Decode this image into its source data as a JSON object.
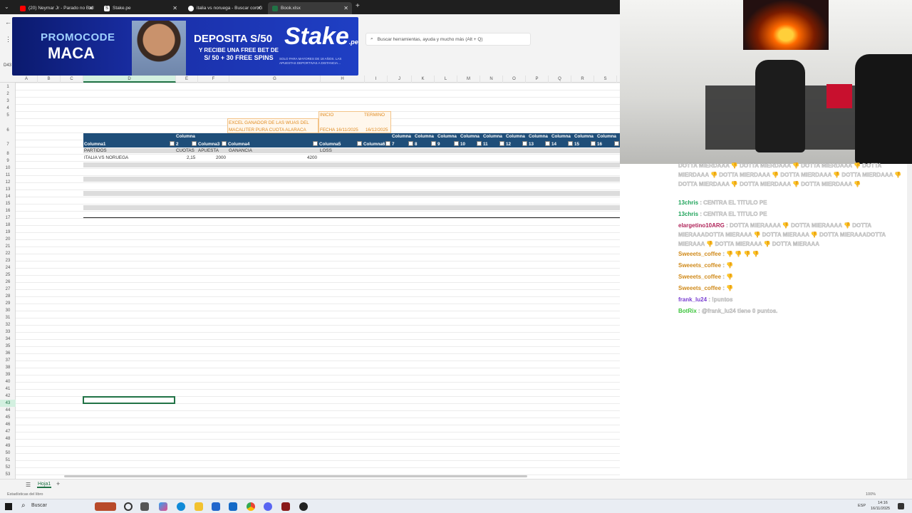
{
  "browser": {
    "tabs": [
      {
        "label": "(20) Neymar Jr - Parado no Bail",
        "icon": "youtube-icon",
        "color": "#ff0000"
      },
      {
        "label": "Stake.pe",
        "icon": "stake-icon",
        "color": "#ffffff"
      },
      {
        "label": "italia vs noruega - Buscar con G",
        "icon": "google-icon",
        "color": "#ffffff"
      },
      {
        "label": "Book.xlsx",
        "icon": "excel-icon",
        "color": "#217346"
      }
    ],
    "new_tab": "+"
  },
  "excel": {
    "search_placeholder": "Buscar herramientas, ayuda y mucho más (Alt + Q)",
    "columns": [
      "A",
      "B",
      "C",
      "D",
      "E",
      "F",
      "G",
      "H",
      "I",
      "J",
      "K",
      "L",
      "M",
      "N",
      "O",
      "P",
      "Q",
      "R",
      "S"
    ],
    "rows": [
      "1",
      "2",
      "3",
      "4",
      "5",
      "6",
      "7",
      "8",
      "9",
      "10",
      "11",
      "12",
      "13",
      "14",
      "15",
      "16",
      "17",
      "18",
      "19",
      "20",
      "21",
      "22",
      "23",
      "24",
      "25",
      "26",
      "27",
      "28",
      "29",
      "30",
      "31",
      "32",
      "33",
      "34",
      "35",
      "36",
      "37",
      "38",
      "39",
      "40",
      "41",
      "42",
      "43",
      "44",
      "45",
      "46",
      "47",
      "48",
      "49",
      "50",
      "51",
      "52",
      "53"
    ],
    "cells": {
      "inicio": "INICIO",
      "termino": "TERMINO",
      "title_line1": "EXCEL GANADOR DE LAS WUAS DEL",
      "title_line2": "MACALITER PURA CUOTA ALARACA",
      "fecha_inicio": "FECHA 16/11/2025",
      "fecha_fin": "16/12/2025",
      "partidos": "PARTIDOS",
      "cuotas": "CUOTAS",
      "apuesta": "APUESTA",
      "ganancia": "GANANCIA",
      "loss": "LOSS",
      "match": "ITALIA VS NORUEGA",
      "odd": "2,15",
      "bet": "2000",
      "profit": "4200"
    },
    "table_headers": [
      {
        "l1": "",
        "l2": "Columna1"
      },
      {
        "l1": "Columna",
        "l2": "2"
      },
      {
        "l1": "",
        "l2": "Columna3"
      },
      {
        "l1": "",
        "l2": "Columna4"
      },
      {
        "l1": "",
        "l2": "Columna5"
      },
      {
        "l1": "",
        "l2": "Columna6"
      },
      {
        "l1": "Columna",
        "l2": "7"
      },
      {
        "l1": "Columna",
        "l2": "8"
      },
      {
        "l1": "Columna",
        "l2": "9"
      },
      {
        "l1": "Columna",
        "l2": "10"
      },
      {
        "l1": "Columna",
        "l2": "11"
      },
      {
        "l1": "Columna",
        "l2": "12"
      },
      {
        "l1": "Columna",
        "l2": "13"
      },
      {
        "l1": "Columna",
        "l2": "14"
      },
      {
        "l1": "Columna",
        "l2": "15"
      },
      {
        "l1": "Columna",
        "l2": "16"
      }
    ],
    "sheet_tab": "Hoja1",
    "add_sheet": "+",
    "status_left": "Estadísticas del libro",
    "zoom": "100%"
  },
  "banner": {
    "promo": "PROMOCODE",
    "maca": "MACA",
    "deposita": "DEPOSITA S/50",
    "free_line1": "Y RECIBE UNA FREE BET DE",
    "free_line2": "S/ 50 + 30 FREE SPINS",
    "brand": "Stake",
    "brand_suffix": ".pe",
    "fine_print": "SOLO PARA MAYORES DE 18 AÑOS. LAS APUESTAS DEPORTIVAS A DISTANCIA..."
  },
  "chat": {
    "messages": [
      {
        "user": "",
        "text": "DOTTA MIERDAAA 👎 DOTTA MIERDAAA 👎 DOTTA MIERDAAA 👎 DOTTA MIERDAAA 👎 DOTTA MIERDAAA 👎 DOTTA MIERDAAA 👎 DOTTA MIERDAAA 👎 DOTTA MIERDAAA 👎 DOTTA MIERDAAA 👎 DOTTA MIERDAAA 👎",
        "color": "#1a4fa0"
      },
      {
        "user": "13chris",
        "text": " : CENTRA EL TITULO PE",
        "color": "#1fa35a"
      },
      {
        "user": "13chris",
        "text": " : CENTRA EL TITULO PE",
        "color": "#1fa35a"
      },
      {
        "user": "elargetino10ARG",
        "text": " : DOTTA MIERAAAA 👎 DOTTA MIERAAAA 👎 DOTTA MIERAAADOTTA MIERAAA 👎 DOTTA MIERAAA 👎 DOTTA MIERAAADOTTA MIERAAA 👎 DOTTA MIERAAA 👎 DOTTA MIERAAA",
        "color": "#b0245a"
      },
      {
        "user": "Sweeets_coffee",
        "text": " : 👎 👎 👎 👎",
        "color": "#d08a1a"
      },
      {
        "user": "Sweeets_coffee",
        "text": " : 👎",
        "color": "#d08a1a"
      },
      {
        "user": "Sweeets_coffee",
        "text": " : 👎",
        "color": "#d08a1a"
      },
      {
        "user": "Sweeets_coffee",
        "text": " : 👎",
        "color": "#d08a1a"
      },
      {
        "user": "frank_lu24",
        "text": " : !puntos",
        "color": "#7a3fd1"
      },
      {
        "user": "BotRix",
        "text": " : @frank_lu24 tiene 0 puntos.",
        "color": "#3cc43c"
      }
    ]
  },
  "taskbar": {
    "search": "Buscar",
    "lang": "ESP",
    "time": "14:16",
    "date": "16/11/2025"
  }
}
